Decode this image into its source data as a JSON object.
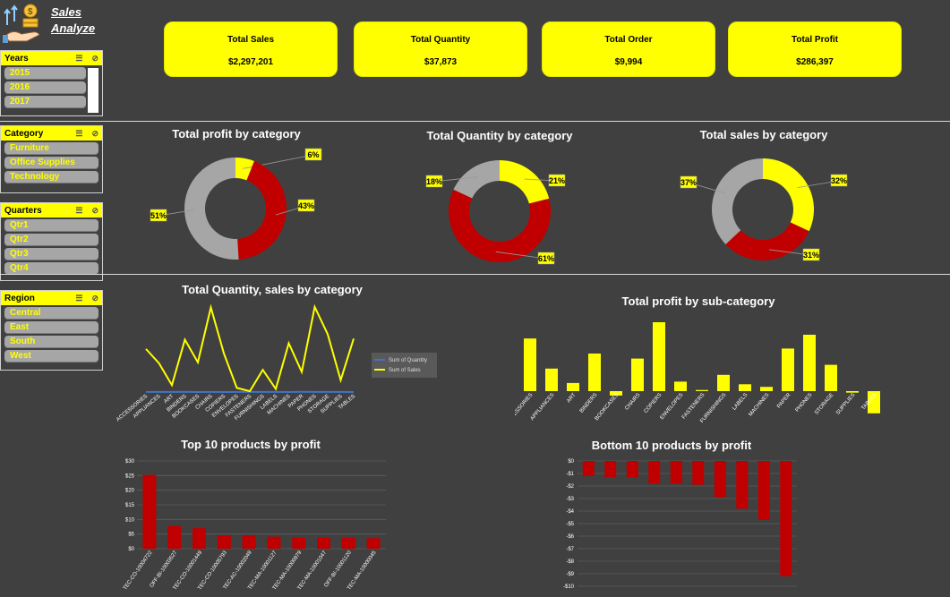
{
  "header": {
    "title_line1": "Sales",
    "title_line2": "Analyze"
  },
  "slicers": {
    "years": {
      "title": "Years",
      "items": [
        "2015",
        "2016",
        "2017"
      ]
    },
    "category": {
      "title": "Category",
      "items": [
        "Furniture",
        "Office Supplies",
        "Technology"
      ]
    },
    "quarters": {
      "title": "Quarters",
      "items": [
        "Qtr1",
        "Qtr2",
        "Qtr3",
        "Qtr4"
      ]
    },
    "region": {
      "title": "Region",
      "items": [
        "Central",
        "East",
        "South",
        "West"
      ]
    }
  },
  "kpis": [
    {
      "label": "Total Sales",
      "value": "$2,297,201"
    },
    {
      "label": "Total Quantity",
      "value": "$37,873"
    },
    {
      "label": "Total Order",
      "value": "$9,994"
    },
    {
      "label": "Total Profit",
      "value": "$286,397"
    }
  ],
  "colors": {
    "accent": "#ffff00",
    "red": "#c00000",
    "gray": "#a6a6a6",
    "background": "#404040"
  },
  "chart_data": [
    {
      "type": "pie",
      "variant": "doughnut",
      "title": "Total profit by category",
      "slices": [
        {
          "label": "6%",
          "value": 6,
          "color": "#ffff00"
        },
        {
          "label": "43%",
          "value": 43,
          "color": "#c00000"
        },
        {
          "label": "51%",
          "value": 51,
          "color": "#a6a6a6"
        }
      ]
    },
    {
      "type": "pie",
      "variant": "doughnut",
      "title": "Total Quantity by category",
      "slices": [
        {
          "label": "21%",
          "value": 21,
          "color": "#ffff00"
        },
        {
          "label": "61%",
          "value": 61,
          "color": "#c00000"
        },
        {
          "label": "18%",
          "value": 18,
          "color": "#a6a6a6"
        }
      ]
    },
    {
      "type": "pie",
      "variant": "doughnut",
      "title": "Total sales by category",
      "slices": [
        {
          "label": "32%",
          "value": 32,
          "color": "#ffff00"
        },
        {
          "label": "31%",
          "value": 31,
          "color": "#c00000"
        },
        {
          "label": "37%",
          "value": 37,
          "color": "#a6a6a6"
        }
      ]
    },
    {
      "type": "line",
      "title": "Total Quantity, sales by category",
      "categories": [
        "ACCESSORIES",
        "APPLIANCES",
        "ART",
        "BINDERS",
        "BOOKCASES",
        "CHAIRS",
        "COPIERS",
        "ENVELOPES",
        "FASTENERS",
        "FURNISHINGS",
        "LABELS",
        "MACHINES",
        "PAPER",
        "PHONES",
        "STORAGE",
        "SUPPLIES",
        "TABLES"
      ],
      "legend": [
        "Sum of Quantity",
        "Sum of Sales"
      ],
      "legend_position": "right",
      "series": [
        {
          "name": "Sum of Quantity",
          "color": "#4472c4",
          "values": [
            0.4,
            0.3,
            0.3,
            0.9,
            0.2,
            0.4,
            0.1,
            0.3,
            0.4,
            0.5,
            0.3,
            0.2,
            0.7,
            0.5,
            0.5,
            0.3,
            0.2
          ]
        },
        {
          "name": "Sum of Sales",
          "color": "#ffff00",
          "values": [
            167,
            112,
            27,
            203,
            115,
            328,
            150,
            16,
            3,
            86,
            12,
            189,
            78,
            330,
            224,
            46,
            207
          ]
        }
      ],
      "ylim": [
        0,
        340
      ]
    },
    {
      "type": "bar",
      "title": "Total profit by sub-category",
      "categories": [
        "ACCESSORIES",
        "APPLIANCES",
        "ART",
        "BINDERS",
        "BOOKCASES",
        "CHAIRS",
        "COPIERS",
        "ENVELOPES",
        "FASTENERS",
        "FURNISHINGS",
        "LABELS",
        "MACHINES",
        "PAPER",
        "PHONES",
        "STORAGE",
        "SUPPLIES",
        "TABLES"
      ],
      "values": [
        42,
        18,
        6.5,
        30,
        -3.5,
        26,
        55,
        7.6,
        0.9,
        13,
        5.5,
        3.4,
        34,
        45,
        21,
        -1.2,
        -17.7
      ],
      "ylim": [
        -20,
        60
      ],
      "color": "#ffff00"
    },
    {
      "type": "bar",
      "title": "Top 10 products by profit",
      "categories": [
        "TEC-CO-10004722",
        "OFF-BI-10003527",
        "TEC-CO-10001449",
        "TEC-CO-10005793",
        "TEC-AC-10002049",
        "TEC-MA-10001127",
        "TEC-MA-10000979",
        "TEC-MA-10001047",
        "OFF-BI-10001120",
        "TEC-MA-10000045"
      ],
      "values": [
        25.2,
        7.8,
        7.0,
        4.6,
        4.6,
        4.1,
        3.8,
        3.7,
        3.7,
        3.6
      ],
      "yticks": [
        "$0",
        "$5",
        "$10",
        "$15",
        "$20",
        "$25",
        "$30"
      ],
      "ylim": [
        0,
        30
      ],
      "color": "#c00000"
    },
    {
      "type": "bar",
      "title": "Bottom 10 products by profit",
      "values": [
        -1.2,
        -1.3,
        -1.3,
        -1.8,
        -1.8,
        -1.9,
        -2.9,
        -3.8,
        -4.7,
        -9.2
      ],
      "yticks": [
        "$0",
        "-$1",
        "-$2",
        "-$3",
        "-$4",
        "-$5",
        "-$6",
        "-$7",
        "-$8",
        "-$9",
        "-$10"
      ],
      "ylim": [
        -10,
        0
      ],
      "color": "#c00000"
    }
  ]
}
